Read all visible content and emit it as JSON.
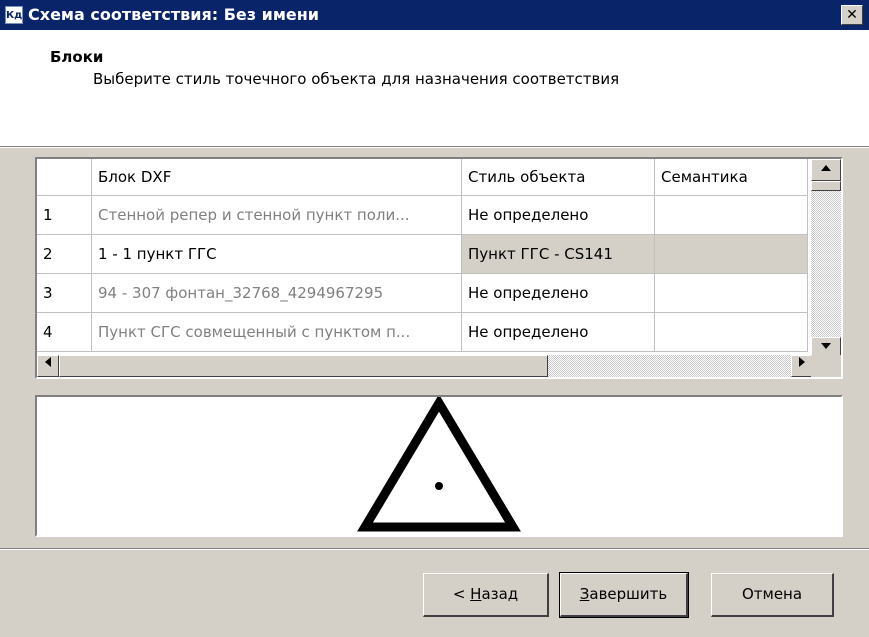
{
  "window": {
    "app_icon": "Кд",
    "title": "Схема соответствия: Без имени",
    "close_glyph": "✕"
  },
  "header": {
    "title": "Блоки",
    "subtitle": "Выберите стиль точечного объекта для назначения соответствия"
  },
  "grid": {
    "columns": [
      "Блок DXF",
      "Стиль объекта",
      "Семантика"
    ],
    "rows": [
      {
        "num": "1",
        "block": "Стенной репер и стенной пункт поли...",
        "style": "Не определено",
        "semantic": ""
      },
      {
        "num": "2",
        "block": "1 - 1 пункт ГГС",
        "style": "Пункт ГГС - CS141",
        "semantic": ""
      },
      {
        "num": "3",
        "block": "94 - 307 фонтан_32768_4294967295",
        "style": "Не определено",
        "semantic": ""
      },
      {
        "num": "4",
        "block": "Пункт СГС совмещенный с пунктом п...",
        "style": "Не определено",
        "semantic": ""
      }
    ],
    "selected_row": "2"
  },
  "preview": {
    "symbol": "triangle-with-dot-icon"
  },
  "buttons": {
    "back_prefix": "< ",
    "back_key": "Н",
    "back_rest": "азад",
    "finish_key": "З",
    "finish_rest": "авершить",
    "cancel": "Отмена"
  }
}
